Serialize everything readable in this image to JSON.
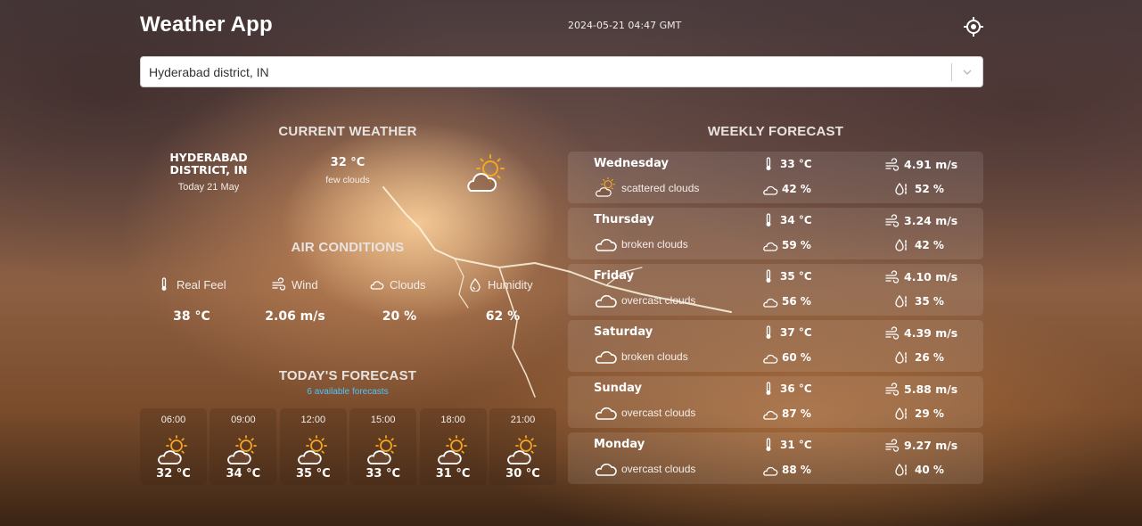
{
  "header": {
    "title": "Weather App",
    "datetime": "2024-05-21 04:47 GMT",
    "locate_icon": "crosshair-icon"
  },
  "search": {
    "value": "Hyderabad district, IN",
    "dropdown_icon": "chevron-down-icon"
  },
  "current": {
    "section_title": "CURRENT WEATHER",
    "city": "HYDERABAD DISTRICT, IN",
    "date": "Today 21 May",
    "temperature": "32 °C",
    "description": "few clouds",
    "icon": "sun-cloud-icon"
  },
  "air": {
    "section_title": "AIR CONDITIONS",
    "items": [
      {
        "label": "Real Feel",
        "value": "38 °C",
        "icon": "thermometer-icon"
      },
      {
        "label": "Wind",
        "value": "2.06 m/s",
        "icon": "wind-icon"
      },
      {
        "label": "Clouds",
        "value": "20 %",
        "icon": "cloud-icon"
      },
      {
        "label": "Humidity",
        "value": "62 %",
        "icon": "humidity-icon"
      }
    ]
  },
  "today": {
    "section_title": "TODAY'S FORECAST",
    "subtitle": "6 available forecasts",
    "hours": [
      {
        "time": "06:00",
        "temp": "32 °C",
        "icon": "sun-cloud-icon"
      },
      {
        "time": "09:00",
        "temp": "34 °C",
        "icon": "sun-cloud-icon"
      },
      {
        "time": "12:00",
        "temp": "35 °C",
        "icon": "sun-cloud-icon"
      },
      {
        "time": "15:00",
        "temp": "33 °C",
        "icon": "sun-cloud-icon"
      },
      {
        "time": "18:00",
        "temp": "31 °C",
        "icon": "sun-cloud-icon"
      },
      {
        "time": "21:00",
        "temp": "30 °C",
        "icon": "sun-cloud-icon"
      }
    ]
  },
  "weekly": {
    "section_title": "WEEKLY FORECAST",
    "days": [
      {
        "day": "Wednesday",
        "temp": "33 °C",
        "wind": "4.91 m/s",
        "desc": "scattered clouds",
        "clouds": "42 %",
        "humidity": "52 %",
        "icon": "sun-cloud-icon"
      },
      {
        "day": "Thursday",
        "temp": "34 °C",
        "wind": "3.24 m/s",
        "desc": "broken clouds",
        "clouds": "59 %",
        "humidity": "42 %",
        "icon": "cloud-icon"
      },
      {
        "day": "Friday",
        "temp": "35 °C",
        "wind": "4.10 m/s",
        "desc": "overcast clouds",
        "clouds": "56 %",
        "humidity": "35 %",
        "icon": "cloud-icon"
      },
      {
        "day": "Saturday",
        "temp": "37 °C",
        "wind": "4.39 m/s",
        "desc": "broken clouds",
        "clouds": "60 %",
        "humidity": "26 %",
        "icon": "cloud-icon"
      },
      {
        "day": "Sunday",
        "temp": "36 °C",
        "wind": "5.88 m/s",
        "desc": "overcast clouds",
        "clouds": "87 %",
        "humidity": "29 %",
        "icon": "cloud-icon"
      },
      {
        "day": "Monday",
        "temp": "31 °C",
        "wind": "9.27 m/s",
        "desc": "overcast clouds",
        "clouds": "88 %",
        "humidity": "40 %",
        "icon": "cloud-icon"
      }
    ]
  },
  "colors": {
    "accent_blue": "#4fc3f7",
    "sun": "#f5a623",
    "row_bg": "rgba(255,255,255,0.10)"
  }
}
